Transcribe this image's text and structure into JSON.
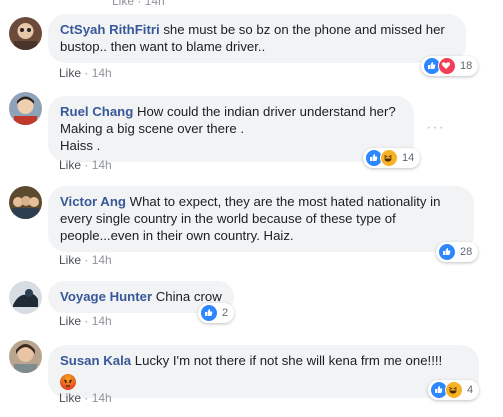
{
  "top_clip": "Like · 14h",
  "comments": [
    {
      "author": "CtSyah RithFitri",
      "text": "she must be so bz on the phone and missed her bustop.. then want to blame driver..",
      "like_label": "Like",
      "time": "14h",
      "reactions": [
        "like",
        "love"
      ],
      "reaction_count": "18"
    },
    {
      "author": "Ruel Chang",
      "text": "How could the indian driver understand her? Making a big scene over there .\nHaiss .",
      "like_label": "Like",
      "time": "14h",
      "reactions": [
        "like",
        "haha"
      ],
      "reaction_count": "14"
    },
    {
      "author": "Victor Ang",
      "text": "What to expect, they are the most hated nationality in every single country in the world because of these type of people...even in their own country. Haiz.",
      "like_label": "Like",
      "time": "14h",
      "reactions": [
        "like"
      ],
      "reaction_count": "28"
    },
    {
      "author": "Voyage Hunter",
      "text": "China crow",
      "like_label": "Like",
      "time": "14h",
      "reactions": [
        "like"
      ],
      "reaction_count": "2"
    },
    {
      "author": "Susan Kala",
      "text": "Lucky I'm not there if not she will kena frm me one!!!!",
      "emoji": "angry-face-emoji",
      "like_label": "Like",
      "time": "14h",
      "reactions": [
        "like",
        "haha"
      ],
      "reaction_count": "4"
    }
  ],
  "colors": {
    "author": "#385898",
    "bubble": "#f2f3f5",
    "like_reaction": "#2d88ff",
    "love_reaction": "#f33e58",
    "haha_reaction": "#f7b125",
    "meta": "#90949c"
  }
}
